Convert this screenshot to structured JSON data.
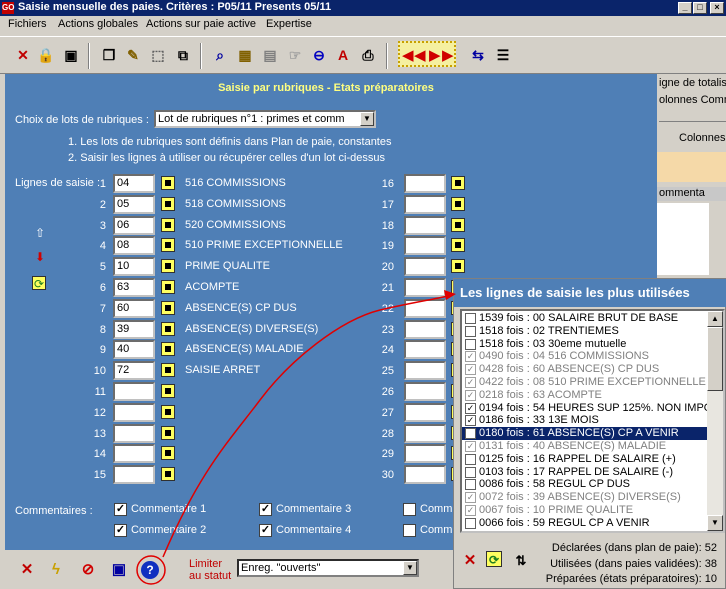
{
  "window": {
    "app_icon": "GO",
    "title": "Saisie mensuelle des paies. Critères : P05/11   Presents 05/11",
    "min": "_",
    "max": "□",
    "close": "×"
  },
  "menu": [
    "Fichiers",
    "Actions globales",
    "Actions sur paie active",
    "Expertise"
  ],
  "toolbar": {
    "icons": [
      "close-icon",
      "lock-icon",
      "monitor-icon",
      "copy-icon",
      "edit-icon",
      "select-icon",
      "network-icon",
      "zoom-icon",
      "calc-icon",
      "save-icon",
      "hand-icon",
      "minus-icon",
      "font-icon",
      "print-icon",
      "first-icon",
      "prev-icon",
      "next-icon",
      "last-icon",
      "transfer-icon",
      "list-icon"
    ]
  },
  "panel": {
    "title": "Saisie par rubriques - Etats préparatoires",
    "lots_label": "Choix de lots de rubriques :",
    "lots_value": "Lot de rubriques n°1 : primes et comm",
    "note1": "1. Les lots de rubriques sont définis dans Plan de paie, constantes",
    "note2": "2. Saisir les lignes à utiliser ou récupérer celles d'un lot ci-dessus",
    "lignes_label": "Lignes de saisie :",
    "rows_left": [
      {
        "n": "1",
        "code": "04",
        "label": "516 COMMISSIONS"
      },
      {
        "n": "2",
        "code": "05",
        "label": "518 COMMISSIONS"
      },
      {
        "n": "3",
        "code": "06",
        "label": "520 COMMISSIONS"
      },
      {
        "n": "4",
        "code": "08",
        "label": "510 PRIME EXCEPTIONNELLE"
      },
      {
        "n": "5",
        "code": "10",
        "label": "PRIME QUALITE"
      },
      {
        "n": "6",
        "code": "63",
        "label": "ACOMPTE"
      },
      {
        "n": "7",
        "code": "60",
        "label": "ABSENCE(S) CP DUS"
      },
      {
        "n": "8",
        "code": "39",
        "label": "ABSENCE(S) DIVERSE(S)"
      },
      {
        "n": "9",
        "code": "40",
        "label": "ABSENCE(S) MALADIE"
      },
      {
        "n": "10",
        "code": "72",
        "label": "SAISIE ARRET"
      },
      {
        "n": "11",
        "code": "",
        "label": ""
      },
      {
        "n": "12",
        "code": "",
        "label": ""
      },
      {
        "n": "13",
        "code": "",
        "label": ""
      },
      {
        "n": "14",
        "code": "",
        "label": ""
      },
      {
        "n": "15",
        "code": "",
        "label": ""
      }
    ],
    "rows_right": [
      "16",
      "17",
      "18",
      "19",
      "20",
      "21",
      "22",
      "23",
      "24",
      "25",
      "26",
      "27",
      "28",
      "29",
      "30"
    ],
    "commentaires_label": "Commentaires :",
    "comments": [
      {
        "label": "Commentaire 1",
        "checked": true
      },
      {
        "label": "Commentaire 2",
        "checked": true
      },
      {
        "label": "Commentaire 3",
        "checked": true
      },
      {
        "label": "Commentaire 4",
        "checked": true
      },
      {
        "label": "Comm",
        "checked": false
      },
      {
        "label": "Comm",
        "checked": false
      }
    ]
  },
  "bottom": {
    "limit_line1": "Limiter",
    "limit_line2": "au statut",
    "statut_value": "Enreg. \"ouverts\""
  },
  "right_bg": {
    "l1": "igne de totalis",
    "l2": "olonnes Comm",
    "l3": "Colonnes",
    "l4": "ommenta"
  },
  "popup": {
    "title": "Les lignes de saisie les plus utilisées",
    "items": [
      {
        "text": "1539 fois : 00 SALAIRE BRUT DE BASE",
        "state": "unchecked"
      },
      {
        "text": "1518 fois : 02 TRENTIEMES",
        "state": "unchecked"
      },
      {
        "text": "1518 fois : 03 30eme mutuelle",
        "state": "unchecked"
      },
      {
        "text": "0490 fois : 04 516 COMMISSIONS",
        "state": "dim"
      },
      {
        "text": "0428 fois : 60 ABSENCE(S) CP DUS",
        "state": "dim"
      },
      {
        "text": "0422 fois : 08 510 PRIME EXCEPTIONNELLE",
        "state": "dim"
      },
      {
        "text": "0218 fois : 63 ACOMPTE",
        "state": "dim"
      },
      {
        "text": "0194 fois : 54 HEURES SUP 125%. NON IMPO",
        "state": "checked"
      },
      {
        "text": "0186 fois : 33 13E MOIS",
        "state": "checked"
      },
      {
        "text": "0180 fois : 61 ABSENCE(S) CP A VENIR",
        "state": "selected"
      },
      {
        "text": "0131 fois : 40 ABSENCE(S) MALADIE",
        "state": "dim"
      },
      {
        "text": "0125 fois : 16 RAPPEL DE SALAIRE (+)",
        "state": "unchecked"
      },
      {
        "text": "0103 fois : 17 RAPPEL DE SALAIRE (-)",
        "state": "unchecked"
      },
      {
        "text": "0086 fois : 58 REGUL CP DUS",
        "state": "unchecked"
      },
      {
        "text": "0072 fois : 39 ABSENCE(S) DIVERSE(S)",
        "state": "dim"
      },
      {
        "text": "0067 fois : 10 PRIME QUALITE",
        "state": "dim"
      },
      {
        "text": "0066 fois : 59 REGUL CP A VENIR",
        "state": "unchecked"
      }
    ],
    "stat1": "Déclarées (dans plan de paie): 52",
    "stat2": "Utilisées (dans paies validées): 38",
    "stat3": "Préparées (états préparatoires): 10"
  },
  "colors": {
    "panel": "#4f7fb6",
    "title_bar": "#0a246a",
    "accent_red": "#d00000",
    "panel_title": "#ffff80"
  }
}
